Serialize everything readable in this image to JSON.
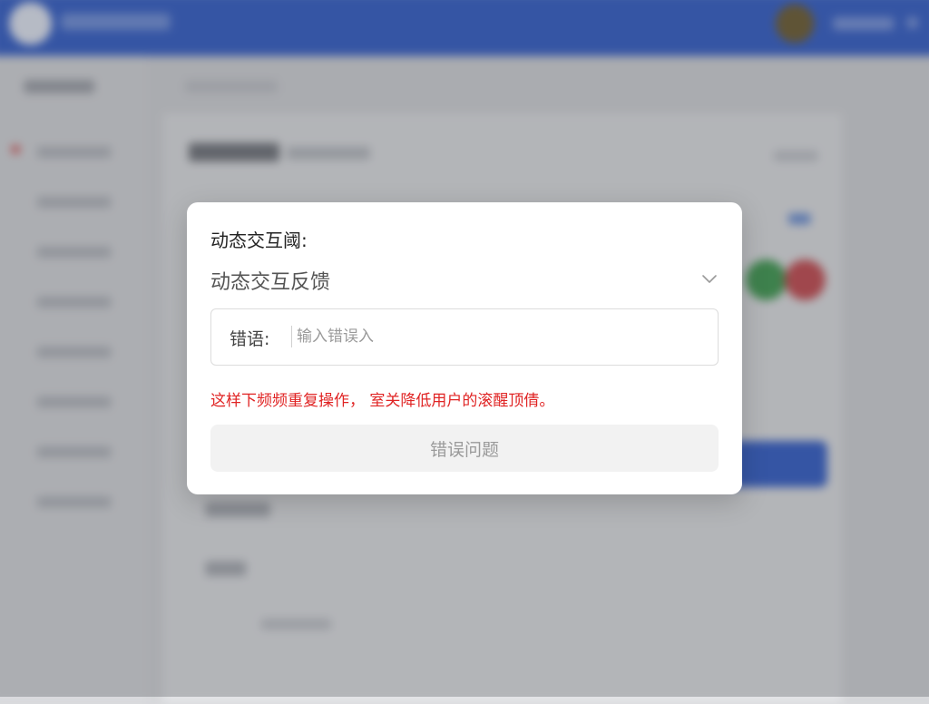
{
  "dialog": {
    "title": "动态交互阈:",
    "select": {
      "value": "动态交互反馈"
    },
    "input": {
      "label": "错语:",
      "placeholder": "输入错误入",
      "value": ""
    },
    "error_message": "这样下频频重复操作， 室关降低用户的滚醒顶倩。",
    "submit_label": "错误问题"
  },
  "colors": {
    "brand": "#2f5bc9",
    "error": "#e02424",
    "success_dot": "#3c9a4c",
    "danger_dot": "#c8474c"
  }
}
